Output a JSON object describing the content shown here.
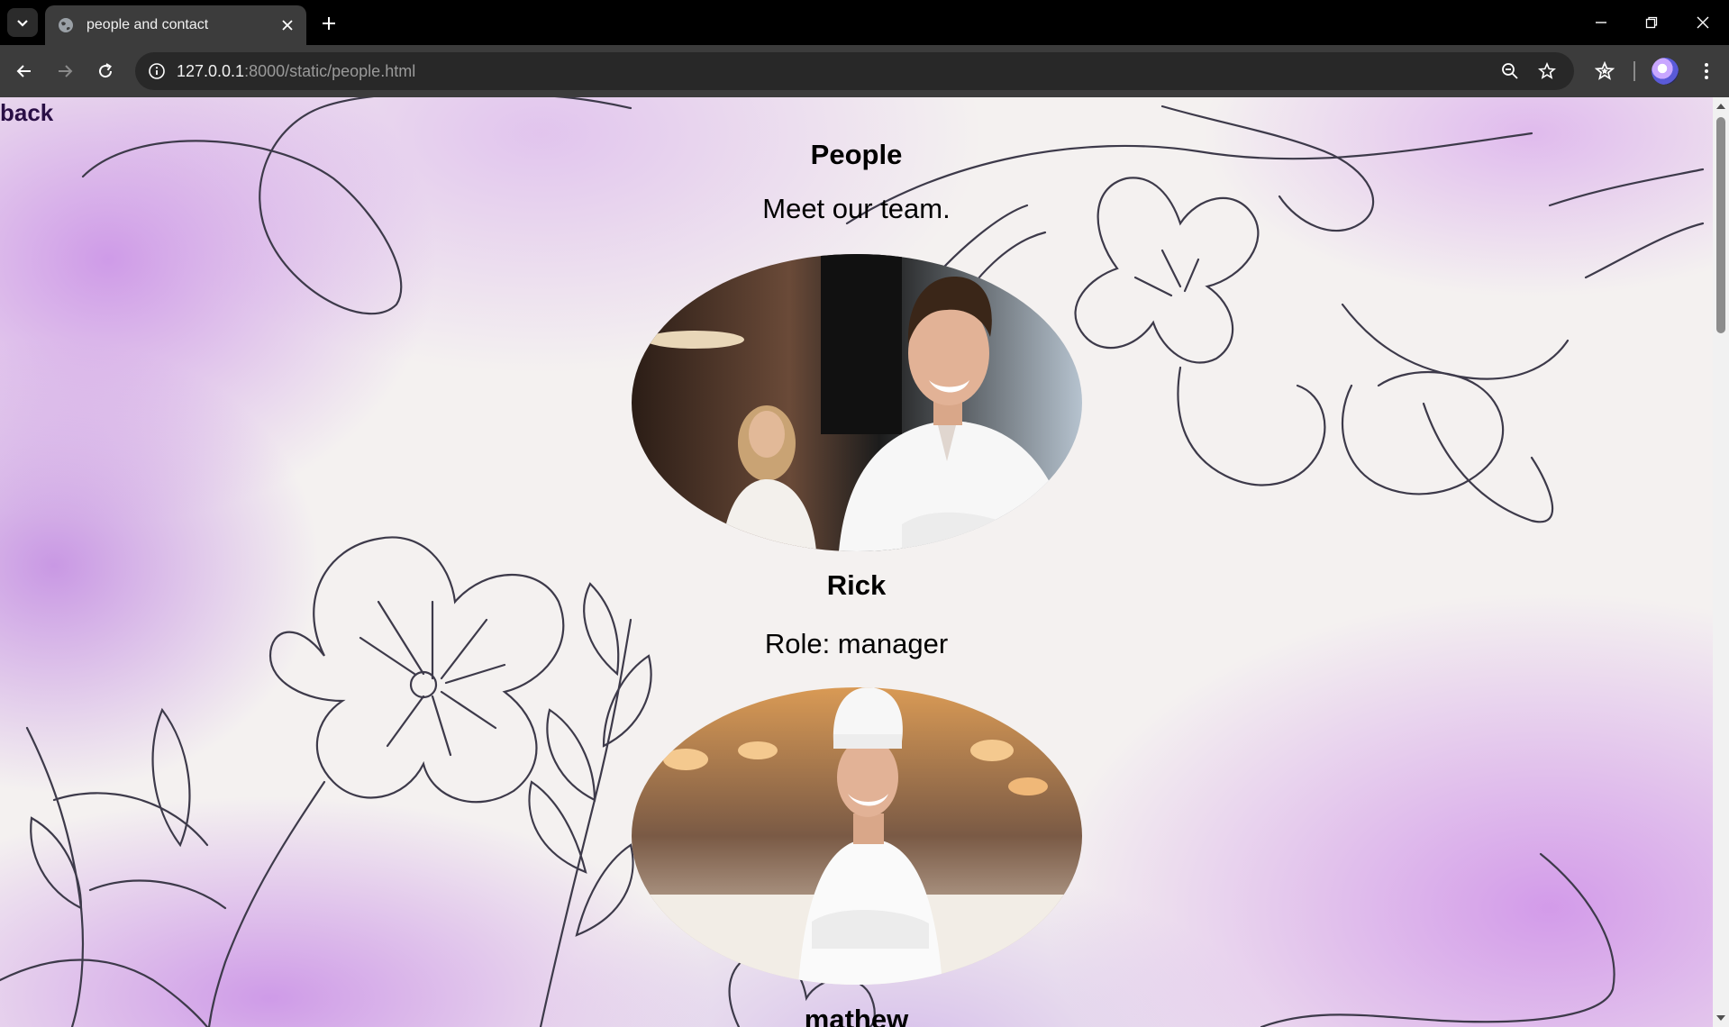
{
  "browser": {
    "tab_title": "people and contact",
    "url_host": "127.0.0.1",
    "url_rest": ":8000/static/people.html"
  },
  "page": {
    "back_label": "back",
    "title": "People",
    "subtitle": "Meet our team.",
    "members": [
      {
        "name": "Rick",
        "role": "Role: manager"
      },
      {
        "name": "mathew",
        "role": ""
      }
    ]
  },
  "colors": {
    "accent_purple": "#c98ee6",
    "text": "#000000",
    "back_link": "#2a0f46"
  }
}
